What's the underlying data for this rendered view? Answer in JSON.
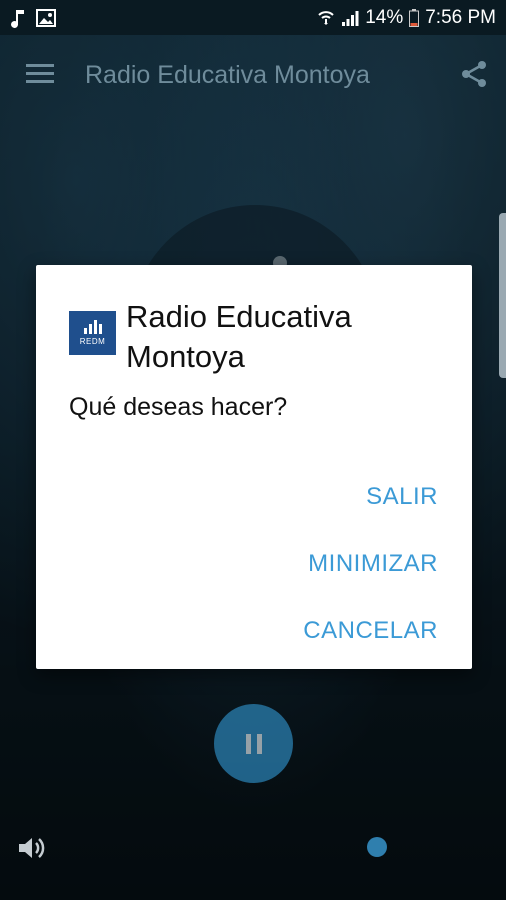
{
  "status_bar": {
    "battery": "14%",
    "time": "7:56 PM"
  },
  "app_bar": {
    "title": "Radio Educativa Montoya",
    "menu_icon": "menu-icon",
    "share_icon": "share-icon"
  },
  "dialog": {
    "logo_text": "REDM",
    "title": "Radio Educativa Montoya",
    "message": "Qué deseas hacer?",
    "buttons": {
      "exit": "SALIR",
      "minimize": "MINIMIZAR",
      "cancel": "CANCELAR"
    },
    "accent_color": "#3b9ad6"
  },
  "player": {
    "play_state_icon": "pause-icon",
    "volume_icon": "volume-icon"
  }
}
